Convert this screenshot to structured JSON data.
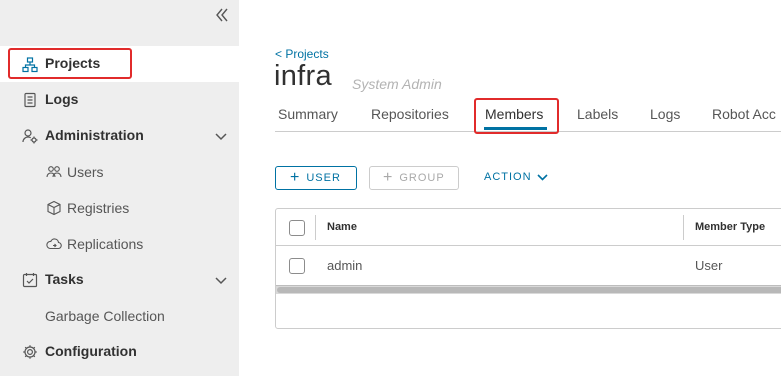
{
  "sidebar": {
    "collapse_icon": "double-chevron-left-icon",
    "items": [
      {
        "label": "Projects",
        "icon": "projects-icon"
      },
      {
        "label": "Logs",
        "icon": "logs-icon"
      },
      {
        "label": "Administration",
        "icon": "administration-icon"
      },
      {
        "label": "Users",
        "icon": "users-icon"
      },
      {
        "label": "Registries",
        "icon": "registries-icon"
      },
      {
        "label": "Replications",
        "icon": "replications-icon"
      },
      {
        "label": "Tasks",
        "icon": "tasks-icon"
      },
      {
        "label": "Garbage Collection"
      },
      {
        "label": "Configuration",
        "icon": "configuration-icon"
      }
    ]
  },
  "header": {
    "back_link": "< Projects",
    "title": "infra",
    "role": "System Admin"
  },
  "tabs": [
    "Summary",
    "Repositories",
    "Members",
    "Labels",
    "Logs",
    "Robot Acc"
  ],
  "active_tab": "Members",
  "toolbar": {
    "user_label": "USER",
    "group_label": "GROUP",
    "action_label": "ACTION"
  },
  "grid": {
    "columns": [
      "Name",
      "Member Type"
    ],
    "rows": [
      {
        "name": "admin",
        "member_type": "User"
      }
    ]
  },
  "colors": {
    "accent": "#0072a3",
    "highlight": "#e12b2b",
    "sidebar_bg": "#eeeeee"
  }
}
